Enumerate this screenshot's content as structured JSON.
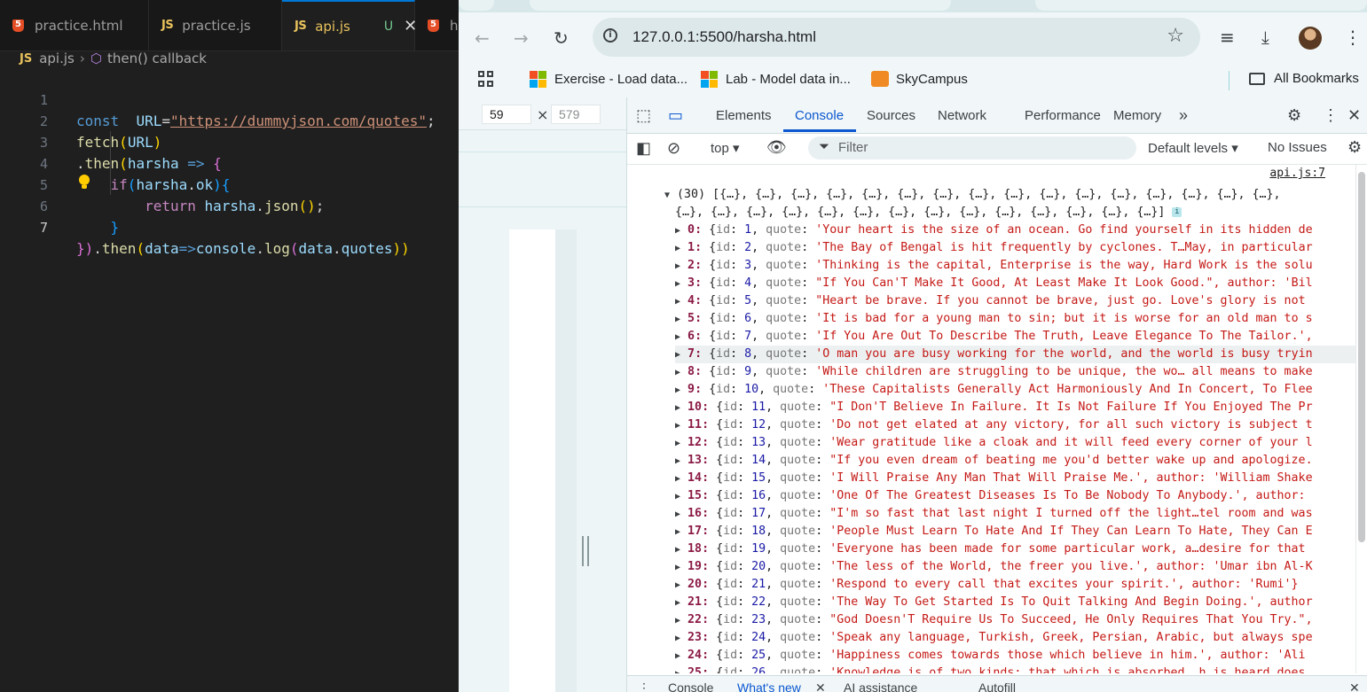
{
  "vscode": {
    "tabs": [
      {
        "label": "practice.html",
        "type": "html"
      },
      {
        "label": "practice.js",
        "type": "js"
      },
      {
        "label": "api.js",
        "type": "js",
        "badge": "U",
        "active": true
      },
      {
        "label": "h",
        "type": "html"
      }
    ],
    "js_icon_text": "JS",
    "breadcrumb": {
      "file": "api.js",
      "symbol": "then() callback"
    },
    "line_numbers": [
      "1",
      "2",
      "3",
      "4",
      "5",
      "6",
      "7"
    ],
    "code": {
      "l1": {
        "kw": "const",
        "var": "URL",
        "eq": "=",
        "str": "\"https://dummyjson.com/quotes\"",
        "end": ";"
      },
      "l2": {
        "fn": "fetch",
        "open": "(",
        "arg": "URL",
        "close": ")"
      },
      "l3": {
        "dot": ".",
        "fn": "then",
        "open": "(",
        "param": "harsha",
        "arrow": " => ",
        "brace": "{"
      },
      "l4": {
        "kw": "if",
        "open": "(",
        "obj": "harsha",
        "dot": ".",
        "prop": "ok",
        "close": ")",
        "brace": "{"
      },
      "l5": {
        "kw": "return",
        "obj": "harsha",
        "dot": ".",
        "fn": "json",
        "call": "()",
        "end": ";"
      },
      "l6": {
        "brace": "}"
      },
      "l7": {
        "close1": "})",
        "dot": ".",
        "fn": "then",
        "open": "(",
        "param": "data",
        "arrow": "=>",
        "obj": "console",
        "dot2": ".",
        "fn2": "log",
        "open2": "(",
        "obj2": "data",
        "dot3": ".",
        "prop": "quotes",
        "close2": "))"
      }
    }
  },
  "chrome": {
    "url": "127.0.0.1:5500/harsha.html",
    "bookmarks": [
      {
        "label": "Exercise - Load data..."
      },
      {
        "label": "Lab - Model data in..."
      },
      {
        "label": "SkyCampus"
      }
    ],
    "all_bookmarks": "All Bookmarks",
    "viewport_width": "59",
    "viewport_height": "579",
    "devtools": {
      "tabs": [
        "Elements",
        "Console",
        "Sources",
        "Network",
        "Performance",
        "Memory"
      ],
      "active_tab": "Console",
      "context": "top",
      "filter_placeholder": "Filter",
      "levels": "Default levels",
      "issues": "No Issues",
      "source_link": "api.js:7",
      "summary_line1": "(30) [{…}, {…}, {…}, {…}, {…}, {…}, {…}, {…}, {…}, {…}, {…}, {…}, {…}, {…}, {…}, {…},",
      "summary_line2": "{…}, {…}, {…}, {…}, {…}, {…}, {…}, {…}, {…}, {…}, {…}, {…}, {…}, {…}]",
      "entries": [
        {
          "idx": "0",
          "id": "1",
          "quote": "'Your heart is the size of an ocean. Go find yourself in its hidden de"
        },
        {
          "idx": "1",
          "id": "2",
          "quote": "'The Bay of Bengal is hit frequently by cyclones. T…May, in particular"
        },
        {
          "idx": "2",
          "id": "3",
          "quote": "'Thinking is the capital, Enterprise is the way, Hard Work is the solu"
        },
        {
          "idx": "3",
          "id": "4",
          "quote": "\"If You Can'T Make It Good, At Least Make It Look Good.\", author: 'Bil"
        },
        {
          "idx": "4",
          "id": "5",
          "quote": "\"Heart be brave. If you cannot be brave, just go. Love's glory is not"
        },
        {
          "idx": "5",
          "id": "6",
          "quote": "'It is bad for a young man to sin; but it is worse for an old man to s"
        },
        {
          "idx": "6",
          "id": "7",
          "quote": "'If You Are Out To Describe The Truth, Leave Elegance To The Tailor.',"
        },
        {
          "idx": "7",
          "id": "8",
          "quote": "'O man you are busy working for the world, and the world is busy tryin"
        },
        {
          "idx": "8",
          "id": "9",
          "quote": "'While children are struggling to be unique, the wo… all means to make"
        },
        {
          "idx": "9",
          "id": "10",
          "quote": "'These Capitalists Generally Act Harmoniously And In Concert, To Flee"
        },
        {
          "idx": "10",
          "id": "11",
          "quote": "\"I Don'T Believe In Failure. It Is Not Failure If You Enjoyed The Pr"
        },
        {
          "idx": "11",
          "id": "12",
          "quote": "'Do not get elated at any victory, for all such victory is subject t"
        },
        {
          "idx": "12",
          "id": "13",
          "quote": "'Wear gratitude like a cloak and it will feed every corner of your l"
        },
        {
          "idx": "13",
          "id": "14",
          "quote": "\"If you even dream of beating me you'd better wake up and apologize."
        },
        {
          "idx": "14",
          "id": "15",
          "quote": "'I Will Praise Any Man That Will Praise Me.', author: 'William Shake"
        },
        {
          "idx": "15",
          "id": "16",
          "quote": "'One Of The Greatest Diseases Is To Be Nobody To Anybody.', author:"
        },
        {
          "idx": "16",
          "id": "17",
          "quote": "\"I'm so fast that last night I turned off the light…tel room and was"
        },
        {
          "idx": "17",
          "id": "18",
          "quote": "'People Must Learn To Hate And If They Can Learn To Hate, They Can E"
        },
        {
          "idx": "18",
          "id": "19",
          "quote": "'Everyone has been made for some particular work, a…desire for that"
        },
        {
          "idx": "19",
          "id": "20",
          "quote": "'The less of the World, the freer you live.', author: 'Umar ibn Al-K"
        },
        {
          "idx": "20",
          "id": "21",
          "quote": "'Respond to every call that excites your spirit.', author: 'Rumi'}"
        },
        {
          "idx": "21",
          "id": "22",
          "quote": "'The Way To Get Started Is To Quit Talking And Begin Doing.', author"
        },
        {
          "idx": "22",
          "id": "23",
          "quote": "\"God Doesn'T Require Us To Succeed, He Only Requires That You Try.\","
        },
        {
          "idx": "23",
          "id": "24",
          "quote": "'Speak any language, Turkish, Greek, Persian, Arabic, but always spe"
        },
        {
          "idx": "24",
          "id": "25",
          "quote": "'Happiness comes towards those which believe in him.', author: 'Ali"
        },
        {
          "idx": "25",
          "id": "26",
          "quote": "'Knowledge is of two kinds: that which is absorbed …h is heard does"
        }
      ],
      "drawer_tabs": [
        "Console",
        "What's new",
        "AI assistance",
        "Autofill"
      ],
      "active_drawer_tab": "What's new"
    }
  }
}
